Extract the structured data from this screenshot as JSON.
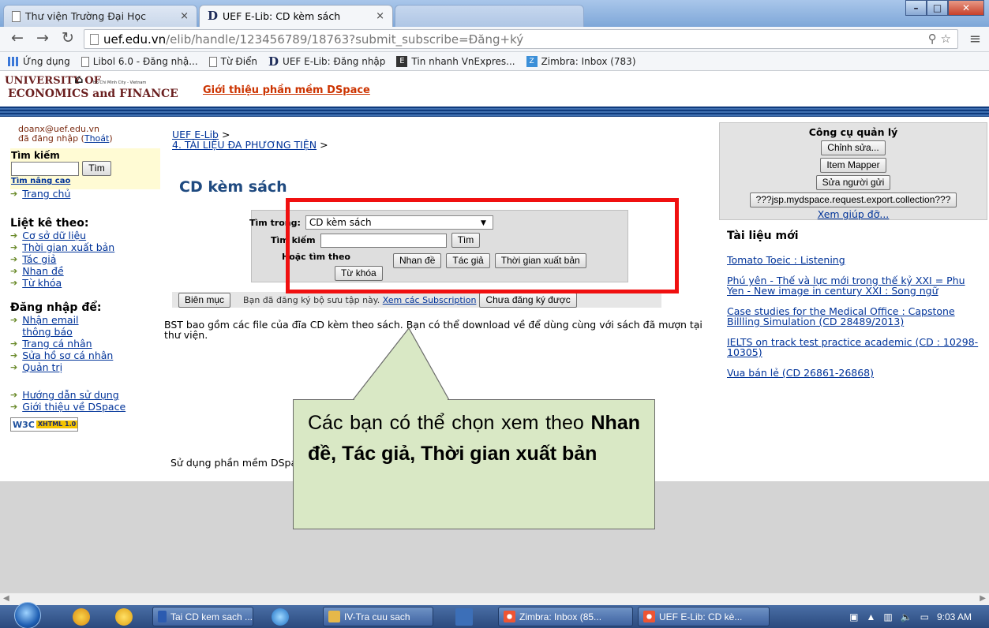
{
  "browser": {
    "tabs": [
      {
        "title": "Thư viện Trường Đại Học",
        "close": "×"
      },
      {
        "title": "UEF E-Lib: CD kèm sách",
        "close": "×"
      }
    ],
    "address": {
      "domain": "uef.edu.vn",
      "path": "/elib/handle/123456789/18763?submit_subscribe=Đăng+ký"
    },
    "bookmarks": [
      "Ứng dụng",
      "Libol 6.0 - Đăng nhậ...",
      "Từ Điển",
      "UEF E-Lib: Đăng nhập",
      "Tin nhanh VnExpres...",
      "Zimbra: Inbox (783)"
    ]
  },
  "header": {
    "logo_line1": "UNIVERSITY OF",
    "logo_line2": "ECONOMICS and FINANCE",
    "logo_small": "Ho Chi Minh City - Vietnam",
    "intro_link": "Giới thiệu phần mềm DSpace"
  },
  "sidebar": {
    "user_email": "doanx@uef.edu.vn",
    "logged_in": "đã đăng nhập (",
    "logout": "Thoát",
    "logged_close": ")",
    "search_title": "Tìm kiếm",
    "search_button": "Tìm",
    "advanced_search": "Tìm nâng cao",
    "home": "Trang chủ",
    "browse_title": "Liệt kê theo:",
    "browse": [
      "Cơ sở dữ liệu",
      "Thời gian xuất bản",
      "Tác giả",
      "Nhan đề",
      "Từ khóa"
    ],
    "login_title": "Đăng nhập để:",
    "login_items": [
      "Nhận email thông báo",
      "Trang cá nhân",
      "Sửa hồ sơ cá nhân",
      "Quản trị"
    ],
    "help": [
      "Hướng dẫn sử dụng",
      "Giới thiệu về DSpace"
    ],
    "w3c": "W3C",
    "xhtml": "XHTML 1.0"
  },
  "main": {
    "breadcrumb_1": "UEF E-Lib",
    "breadcrumb_sep": " >",
    "breadcrumb_2": "4. TÀI LIỆU ĐA PHƯƠNG TIỆN",
    "title": "CD kèm sách",
    "form": {
      "search_in_label": "Tìm trong:",
      "scope_value": "CD kèm sách",
      "search_label": "Tìm kiếm",
      "search_button": "Tìm",
      "or_browse_label": "Hoặc tìm theo",
      "by_title": "Nhan đề",
      "by_author": "Tác giả",
      "by_date": "Thời gian xuất bản",
      "by_keyword": "Từ khóa"
    },
    "browse_button": "Biên mục",
    "subscribed_text": "Bạn đã đăng ký bộ sưu tập này. ",
    "subscriptions_link": "Xem các Subscription",
    "unsubscribe_button": "Chưa đăng ký được",
    "description": "BST bao gồm các file của đĩa CD kèm theo sách. Bạn có thể download về để dùng cùng với sách đã mượn tại thư viện.",
    "footer": "Sử dụng phần mềm DSpace"
  },
  "admin": {
    "title": "Công cụ quản lý",
    "buttons": [
      "Chỉnh sửa...",
      "Item Mapper",
      "Sửa người gửi",
      "???jsp.mydspace.request.export.collection???"
    ],
    "help_link": "Xem giúp đỡ..."
  },
  "news": {
    "title": "Tài liệu mới",
    "items": [
      "Tomato Toeic : Listening",
      "Phú yên - Thế và lực mới trong thế kỷ XXI = Phu Yen - New image in century XXI : Song ngữ",
      "Case studies for the Medical Office : Capstone Billling Simulation (CD 28489/2013)",
      "IELTS on track test practice academic (CD : 10298-10305)",
      "Vua bán lẻ (CD 26861-26868)"
    ]
  },
  "callout": {
    "line1": "Các bạn có thể chọn xem theo ",
    "bold": "Nhan đề, Tác giả, Thời gian xuất bản"
  },
  "taskbar": {
    "items": [
      "Tai CD kem sach ...",
      "IV-Tra cuu sach",
      "Zimbra: Inbox (85...",
      "UEF E-Lib: CD kè..."
    ],
    "clock": "9:03 AM"
  },
  "colors": {
    "accent_red": "#f01010",
    "link": "#003399",
    "callout_bg": "#d9e8c5",
    "title": "#1f4a80"
  }
}
